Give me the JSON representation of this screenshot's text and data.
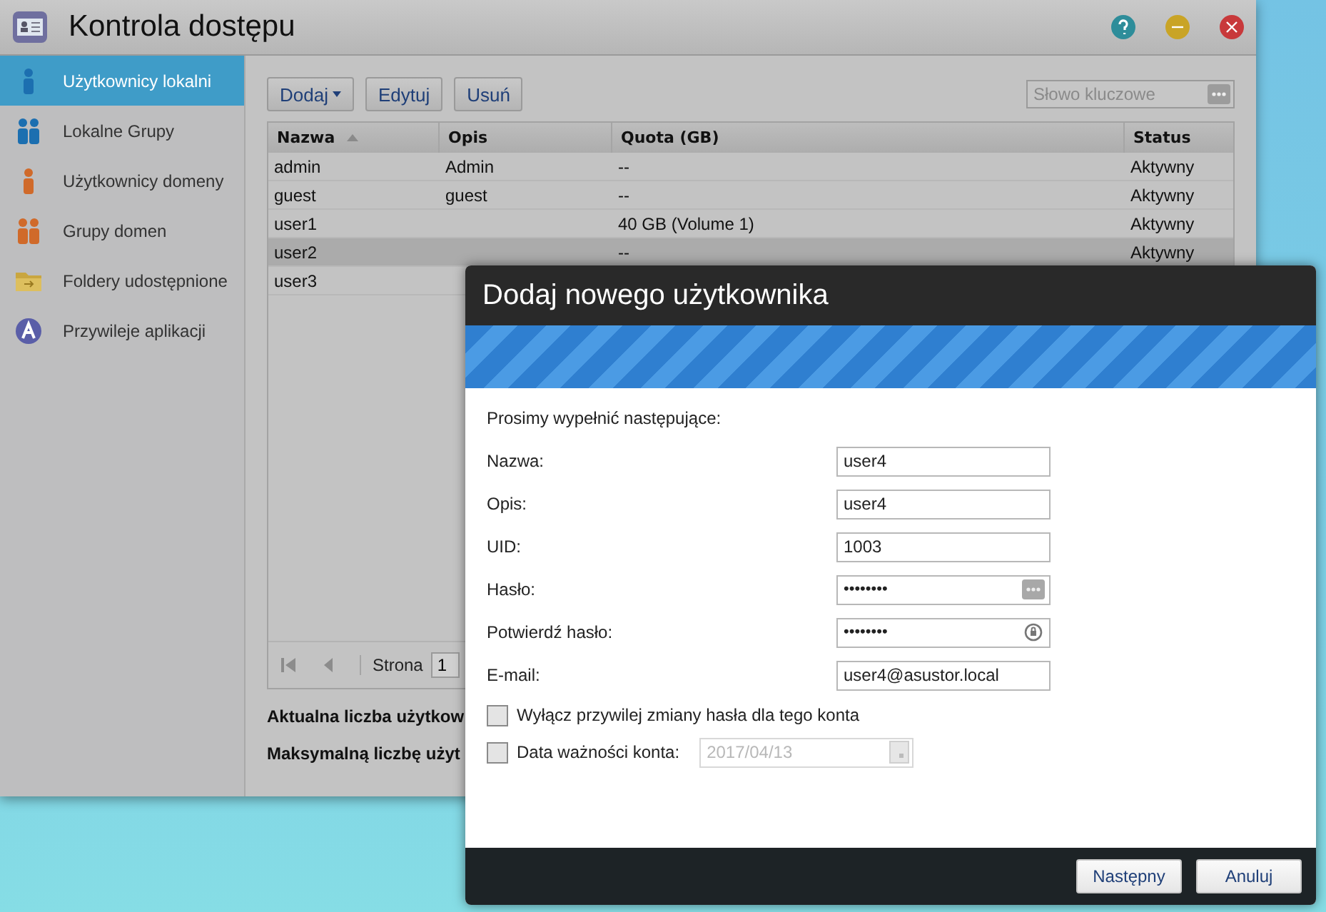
{
  "window": {
    "title": "Kontrola dostępu"
  },
  "sidebar": {
    "items": [
      {
        "label": "Użytkownicy lokalni",
        "selected": true,
        "kind": "user"
      },
      {
        "label": "Lokalne Grupy",
        "selected": false,
        "kind": "group"
      },
      {
        "label": "Użytkownicy domeny",
        "selected": false,
        "kind": "domain-user"
      },
      {
        "label": "Grupy domen",
        "selected": false,
        "kind": "domain-group"
      },
      {
        "label": "Foldery udostępnione",
        "selected": false,
        "kind": "folder"
      },
      {
        "label": "Przywileje aplikacji",
        "selected": false,
        "kind": "app"
      }
    ]
  },
  "toolbar": {
    "buttons": [
      {
        "label": "Dodaj",
        "kind": "dropdown"
      },
      {
        "label": "Edytuj",
        "kind": "plain"
      },
      {
        "label": "Usuń",
        "kind": "plain"
      }
    ],
    "search": {
      "placeholder": "Słowo kluczowe"
    }
  },
  "table": {
    "columns": [
      {
        "label": "Nazwa",
        "sorted": true
      },
      {
        "label": "Opis",
        "sorted": false
      },
      {
        "label": "Quota (GB)",
        "sorted": false
      },
      {
        "label": "Status",
        "sorted": false
      }
    ],
    "rows": [
      {
        "cells": [
          "admin",
          "Admin",
          "--",
          "Aktywny"
        ],
        "selected": false
      },
      {
        "cells": [
          "guest",
          "guest",
          "--",
          "Aktywny"
        ],
        "selected": false
      },
      {
        "cells": [
          "user1",
          "",
          "40 GB (Volume 1)",
          "Aktywny"
        ],
        "selected": false
      },
      {
        "cells": [
          "user2",
          "",
          "--",
          "Aktywny"
        ],
        "selected": true
      },
      {
        "cells": [
          "user3",
          "",
          "",
          ""
        ],
        "selected": false
      }
    ]
  },
  "pager": {
    "label": "Strona",
    "page": "1"
  },
  "footer_notes": [
    "Aktualna liczba użytkow",
    "Maksymalną liczbę użyt"
  ],
  "dialog": {
    "title": "Dodaj nowego użytkownika",
    "intro": "Prosimy wypełnić następujące:",
    "fields": [
      {
        "label": "Nazwa:",
        "value": "user4",
        "kind": "text"
      },
      {
        "label": "Opis:",
        "value": "user4",
        "kind": "text"
      },
      {
        "label": "UID:",
        "value": "1003",
        "kind": "text"
      },
      {
        "label": "Hasło:",
        "value": "••••••••",
        "kind": "password"
      },
      {
        "label": "Potwierdź hasło:",
        "value": "••••••••",
        "kind": "password-confirm"
      },
      {
        "label": "E-mail:",
        "value": "user4@asustor.local",
        "kind": "text"
      }
    ],
    "options": [
      {
        "label": "Wyłącz przywilej zmiany hasła dla tego konta",
        "checked": false,
        "kind": "checkbox"
      },
      {
        "label": "Data ważności konta:",
        "checked": false,
        "kind": "date",
        "value": "2017/04/13",
        "disabled": true
      }
    ],
    "buttons": [
      "Następny",
      "Anuluj"
    ]
  }
}
